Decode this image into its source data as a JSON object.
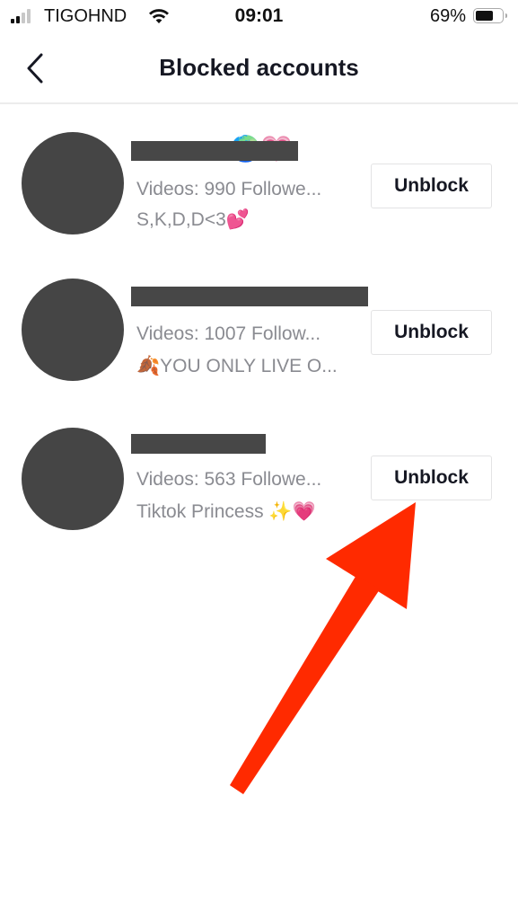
{
  "status_bar": {
    "carrier": "TIGOHND",
    "time": "09:01",
    "battery_percent": "69%",
    "battery_level": 0.69,
    "signal_bars_active": 2,
    "signal_bars_total": 4
  },
  "nav": {
    "back_icon": "chevron-left-icon",
    "title": "Blocked accounts"
  },
  "blocked_accounts": [
    {
      "name_redacted": true,
      "name_visible_fragment": "🌍💗",
      "stats": "Videos: 990  Followe...",
      "bio": "S,K,D,D<3💕",
      "button_label": "Unblock"
    },
    {
      "name_redacted": true,
      "name_visible_fragment": "",
      "stats": "Videos: 1007  Follow...",
      "bio": "🍂YOU ONLY LIVE O...",
      "button_label": "Unblock"
    },
    {
      "name_redacted": true,
      "name_visible_fragment": "",
      "stats": "Videos: 563  Followe...",
      "bio": "Tiktok Princess ✨💗",
      "button_label": "Unblock"
    }
  ],
  "annotation": {
    "type": "arrow",
    "color": "#ff2a00",
    "points_to": "third Unblock button"
  }
}
